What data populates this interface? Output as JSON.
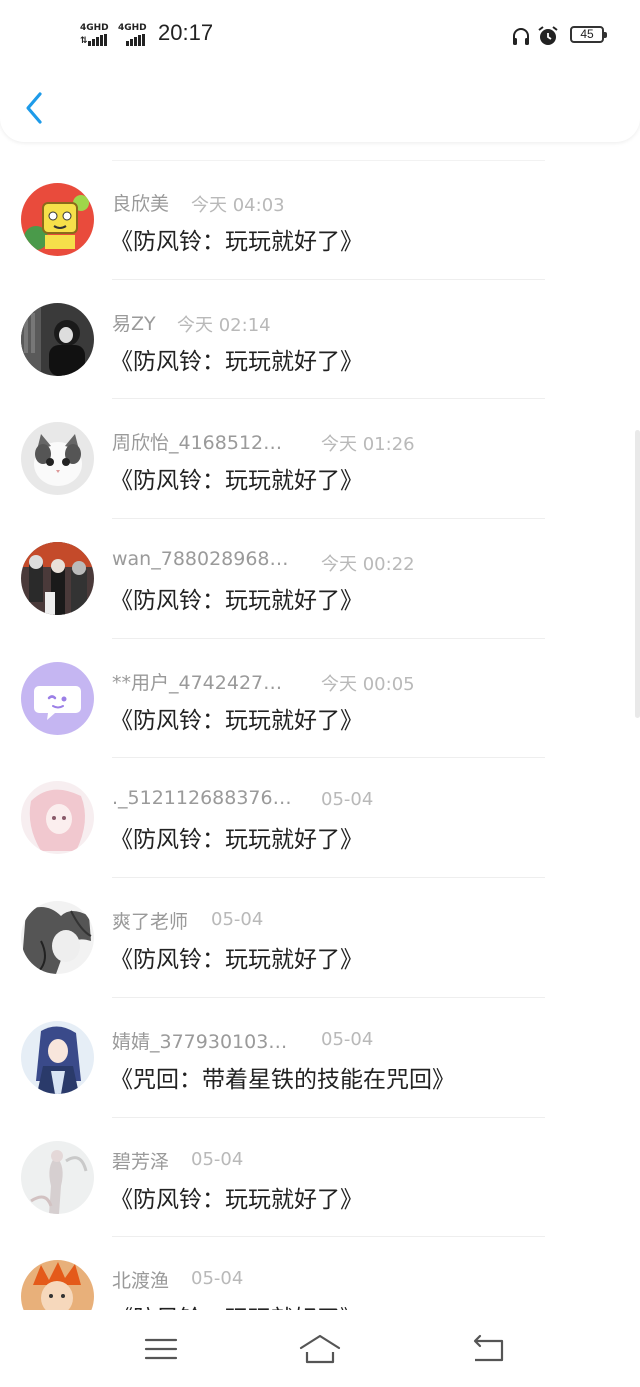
{
  "status_bar": {
    "network_1": "4GHD",
    "network_2": "4GHD",
    "time": "20:17",
    "battery": "45",
    "icons": [
      "headphones-icon",
      "alarm-icon",
      "battery-icon"
    ]
  },
  "header": {
    "back_icon": "chevron-left-icon",
    "accent": "#1e9be9"
  },
  "rows": [
    {
      "name": "良欣美",
      "time": "今天 04:03",
      "message": "《防风铃：玩玩就好了》",
      "avatar": "cartoon-yellow"
    },
    {
      "name": "易ZY",
      "time": "今天 02:14",
      "message": "《防风铃：玩玩就好了》",
      "avatar": "dark-boy"
    },
    {
      "name": "周欣怡_4168512…",
      "time": "今天 01:26",
      "message": "《防风铃：玩玩就好了》",
      "avatar": "cat"
    },
    {
      "name": "wan_788028968…",
      "time": "今天 00:22",
      "message": "《防风铃：玩玩就好了》",
      "avatar": "anime-group"
    },
    {
      "name": "**用户_4742427…",
      "time": "今天 00:05",
      "message": "《防风铃：玩玩就好了》",
      "avatar": "default-purple"
    },
    {
      "name": "._512112688376…",
      "time": "05-04",
      "message": "《防风铃：玩玩就好了》",
      "avatar": "pink-girl"
    },
    {
      "name": "爽了老师",
      "time": "05-04",
      "message": "《防风铃：玩玩就好了》",
      "avatar": "sketch"
    },
    {
      "name": "婧婧_377930103…",
      "time": "05-04",
      "message": "《咒回：带着星铁的技能在咒回》",
      "avatar": "anime-blue"
    },
    {
      "name": "碧芳泽",
      "time": "05-04",
      "message": "《防风铃：玩玩就好了》",
      "avatar": "pale-figure"
    },
    {
      "name": "北渡渔",
      "time": "05-04",
      "message": "《防风铃：玩玩就好了》",
      "avatar": "orange-hair"
    }
  ],
  "navbar": {
    "icons": [
      "menu-icon",
      "home-icon",
      "back-icon"
    ]
  }
}
